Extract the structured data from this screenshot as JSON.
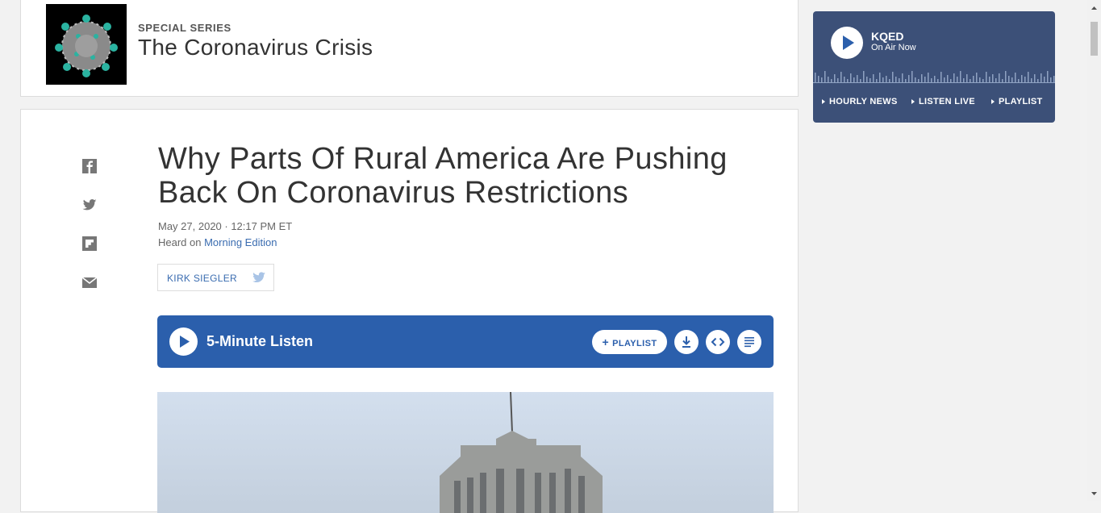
{
  "series": {
    "kicker": "SPECIAL SERIES",
    "title": "The Coronavirus Crisis"
  },
  "article": {
    "headline": "Why Parts Of Rural America Are Pushing Back On Coronavirus Restrictions",
    "date": "May 27, 2020 · 12:17 PM ET",
    "heard_prefix": "Heard on ",
    "heard_show": "Morning Edition",
    "author": "KIRK SIEGLER"
  },
  "share_icons": [
    "facebook-icon",
    "twitter-icon",
    "flipboard-icon",
    "email-icon"
  ],
  "player": {
    "label": "5-Minute Listen",
    "playlist_label": "PLAYLIST",
    "color": "#2b5fac"
  },
  "kqed": {
    "name": "KQED",
    "status": "On Air Now",
    "links": [
      "HOURLY NEWS",
      "LISTEN LIVE",
      "PLAYLIST"
    ],
    "color": "#3c5078"
  }
}
